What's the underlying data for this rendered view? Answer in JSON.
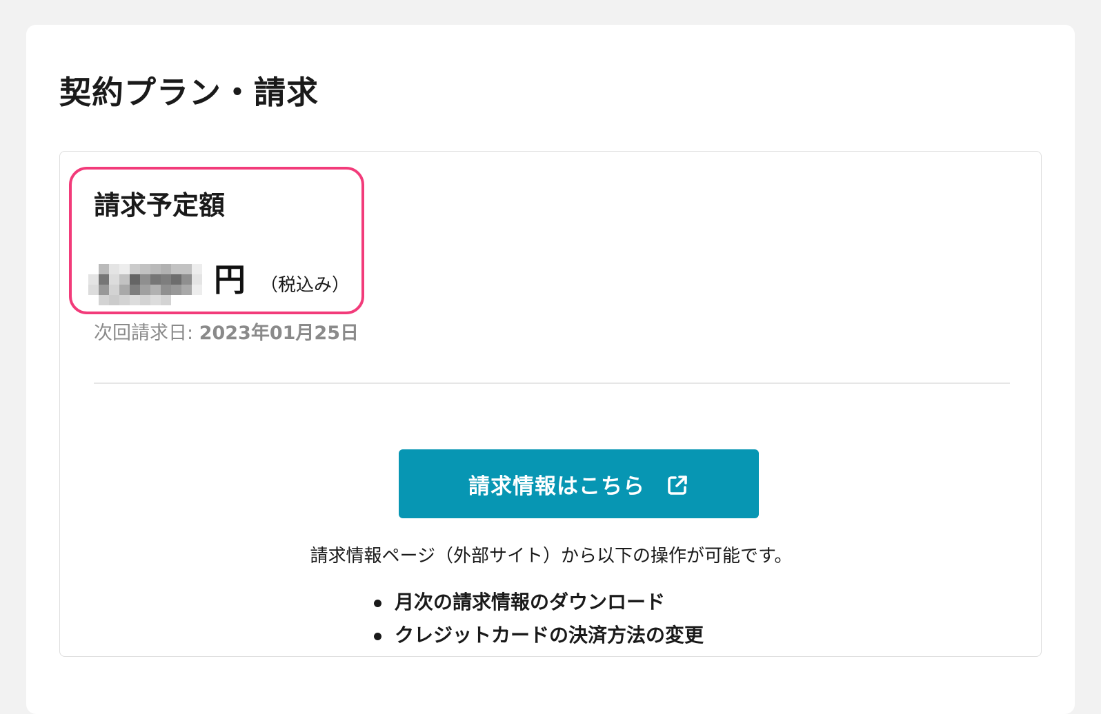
{
  "page": {
    "title": "契約プラン・請求"
  },
  "billing": {
    "amount_label": "請求予定額",
    "amount_value_hidden": true,
    "currency_unit": "円",
    "tax_note": "（税込み）",
    "next_billing_prefix": "次回請求日: ",
    "next_billing_date": "2023年01月25日",
    "highlight_color": "#f23b7a"
  },
  "billing_button": {
    "label": "請求情報はこちら",
    "icon": "external-link-icon",
    "color": "#0796b3"
  },
  "info": {
    "text": "請求情報ページ（外部サイト）から以下の操作が可能です。",
    "items": [
      "月次の請求情報のダウンロード",
      "クレジットカードの決済方法の変更"
    ]
  }
}
